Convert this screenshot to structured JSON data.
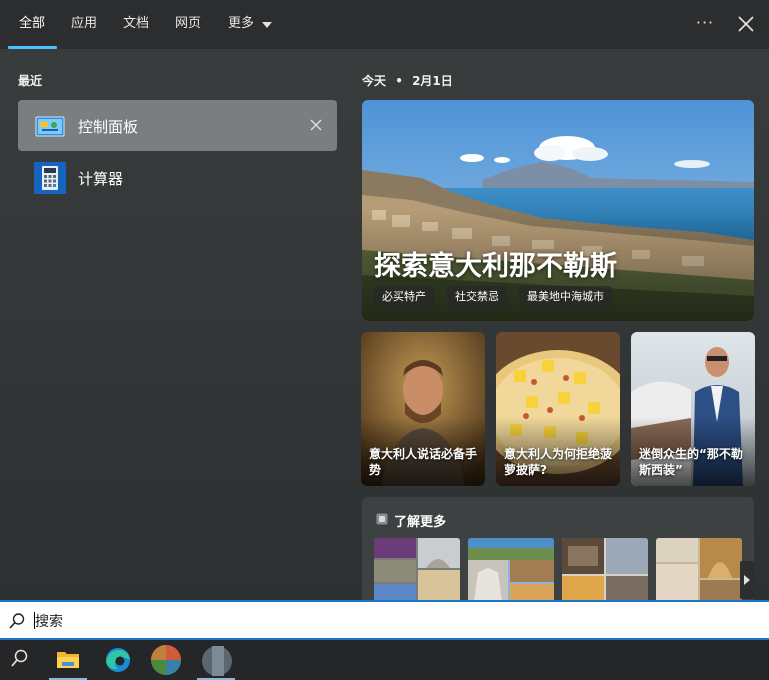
{
  "tabs": [
    {
      "label": "全部",
      "active": true
    },
    {
      "label": "应用",
      "active": false
    },
    {
      "label": "文档",
      "active": false
    },
    {
      "label": "网页",
      "active": false
    },
    {
      "label": "更多",
      "active": false
    }
  ],
  "header": {
    "more_options_icon": "ellipsis-icon",
    "close_icon": "close-icon"
  },
  "recent": {
    "label": "最近",
    "items": [
      {
        "label": "控制面板",
        "icon": "control-panel-icon",
        "selected": true
      },
      {
        "label": "计算器",
        "icon": "calculator-icon",
        "selected": false
      }
    ]
  },
  "today": {
    "label": "今天",
    "separator": "•",
    "date": "2月1日"
  },
  "hero": {
    "title": "探索意大利那不勒斯",
    "chips": [
      "必买特产",
      "社交禁忌",
      "最美地中海城市"
    ]
  },
  "cards": [
    {
      "caption": "意大利人说话必备手势"
    },
    {
      "caption": "意大利人为何拒绝菠萝披萨?"
    },
    {
      "caption": "迷倒众生的“那不勒斯西装”"
    }
  ],
  "learn_more": {
    "label": "了解更多"
  },
  "search": {
    "placeholder": "搜索"
  },
  "taskbar": {
    "items": [
      "search-icon",
      "file-explorer-icon",
      "edge-browser-icon",
      "app-icon",
      "app-icon"
    ]
  },
  "colors": {
    "accent": "#4cc2ff",
    "search_border": "#1f74c8",
    "selected_item": "#7b7e80"
  }
}
